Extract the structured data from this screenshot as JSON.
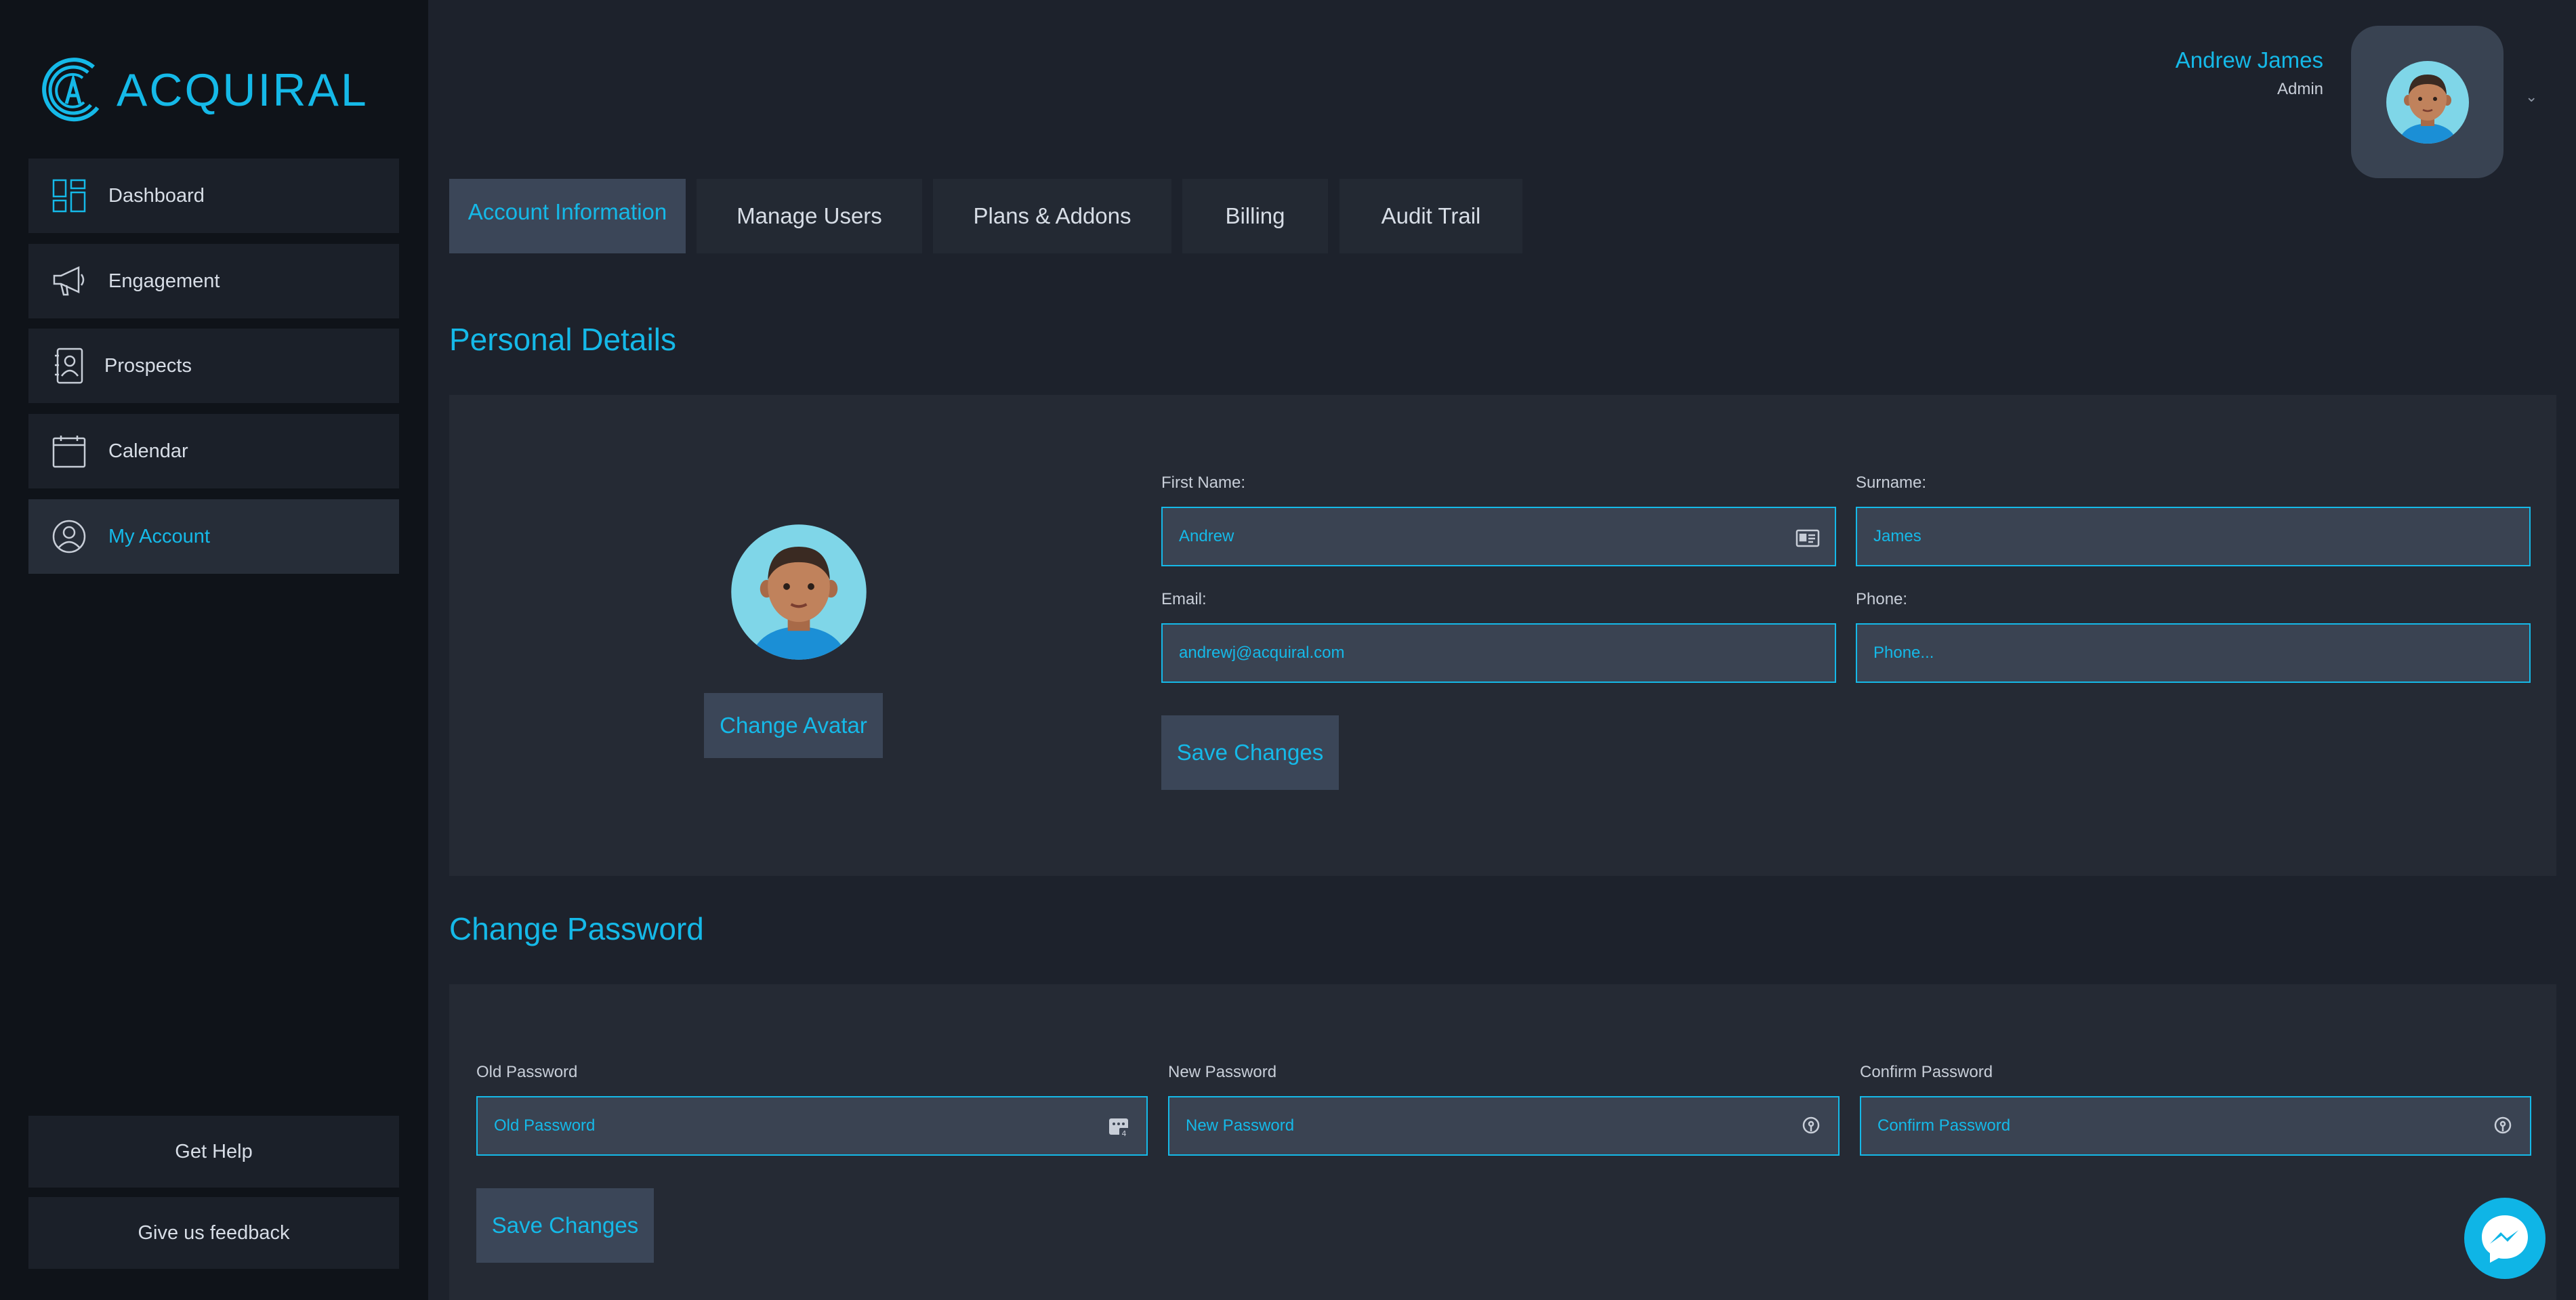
{
  "brand": {
    "name": "ACQUIRAL",
    "accent": "#15b9e8"
  },
  "sidebar": {
    "items": [
      {
        "label": "Dashboard",
        "icon": "dashboard-icon"
      },
      {
        "label": "Engagement",
        "icon": "megaphone-icon"
      },
      {
        "label": "Prospects",
        "icon": "contacts-icon"
      },
      {
        "label": "Calendar",
        "icon": "calendar-icon"
      },
      {
        "label": "My Account",
        "icon": "user-circle-icon",
        "active": true
      }
    ],
    "help_label": "Get Help",
    "feedback_label": "Give us feedback"
  },
  "user": {
    "name": "Andrew James",
    "role": "Admin"
  },
  "tabs": [
    {
      "label": "Account Information",
      "active": true
    },
    {
      "label": "Manage Users"
    },
    {
      "label": "Plans & Addons"
    },
    {
      "label": "Billing"
    },
    {
      "label": "Audit Trail"
    }
  ],
  "personal": {
    "title": "Personal Details",
    "change_avatar_label": "Change Avatar",
    "first_name_label": "First Name:",
    "first_name_value": "Andrew",
    "surname_label": "Surname:",
    "surname_value": "James",
    "email_label": "Email:",
    "email_value": "andrewj@acquiral.com",
    "phone_label": "Phone:",
    "phone_placeholder": "Phone...",
    "save_label": "Save Changes"
  },
  "password": {
    "title": "Change Password",
    "old_label": "Old Password",
    "old_placeholder": "Old Password",
    "new_label": "New Password",
    "new_placeholder": "New Password",
    "confirm_label": "Confirm Password",
    "confirm_placeholder": "Confirm Password",
    "save_label": "Save Changes"
  }
}
